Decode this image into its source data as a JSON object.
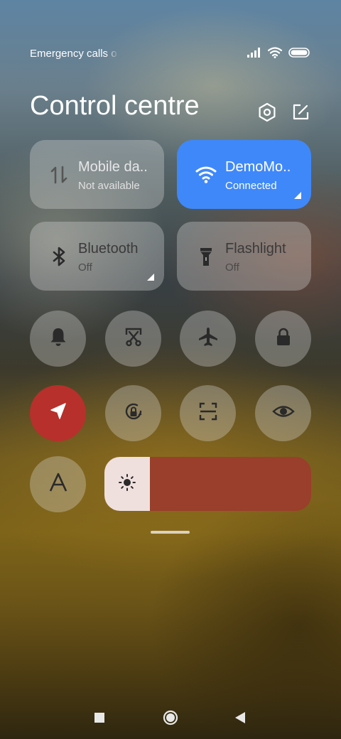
{
  "status_bar": {
    "text": "Emergency calls o",
    "icons": [
      "signal-icon",
      "wifi-icon",
      "battery-icon"
    ]
  },
  "header": {
    "title": "Control centre",
    "icons": [
      "settings-icon",
      "edit-icon"
    ]
  },
  "tiles": [
    {
      "name": "mobile-data",
      "label": "Mobile da..",
      "sub": "Not available",
      "active": false,
      "icon": "mobile-data-icon"
    },
    {
      "name": "wifi",
      "label": "DemoMo..",
      "sub": "Connected",
      "active": true,
      "icon": "wifi-icon"
    },
    {
      "name": "bluetooth",
      "label": "Bluetooth",
      "sub": "Off",
      "active": false,
      "icon": "bluetooth-icon"
    },
    {
      "name": "flashlight",
      "label": "Flashlight",
      "sub": "Off",
      "active": false,
      "icon": "flashlight-icon"
    }
  ],
  "toggles": [
    {
      "name": "ring",
      "icon": "bell-icon",
      "active": false
    },
    {
      "name": "screenshot",
      "icon": "scissors-icon",
      "active": false
    },
    {
      "name": "airplane-mode",
      "icon": "airplane-icon",
      "active": false
    },
    {
      "name": "lock-screen",
      "icon": "lock-icon",
      "active": false
    },
    {
      "name": "location",
      "icon": "location-arrow-icon",
      "active": true
    },
    {
      "name": "rotation-lock",
      "icon": "rotation-lock-icon",
      "active": false
    },
    {
      "name": "scanner",
      "icon": "scan-icon",
      "active": false
    },
    {
      "name": "reading-mode",
      "icon": "eye-icon",
      "active": false
    },
    {
      "name": "font-size",
      "icon": "font-a-icon",
      "active": false
    }
  ],
  "brightness": {
    "level": 0.22,
    "icon": "sun-icon"
  },
  "colors": {
    "accent_blue": "#3f88fa",
    "active_red": "#b7302b",
    "brightness_bar": "#993f2b"
  },
  "nav_bar": {
    "buttons": [
      "recents-button",
      "home-button",
      "back-button"
    ]
  }
}
